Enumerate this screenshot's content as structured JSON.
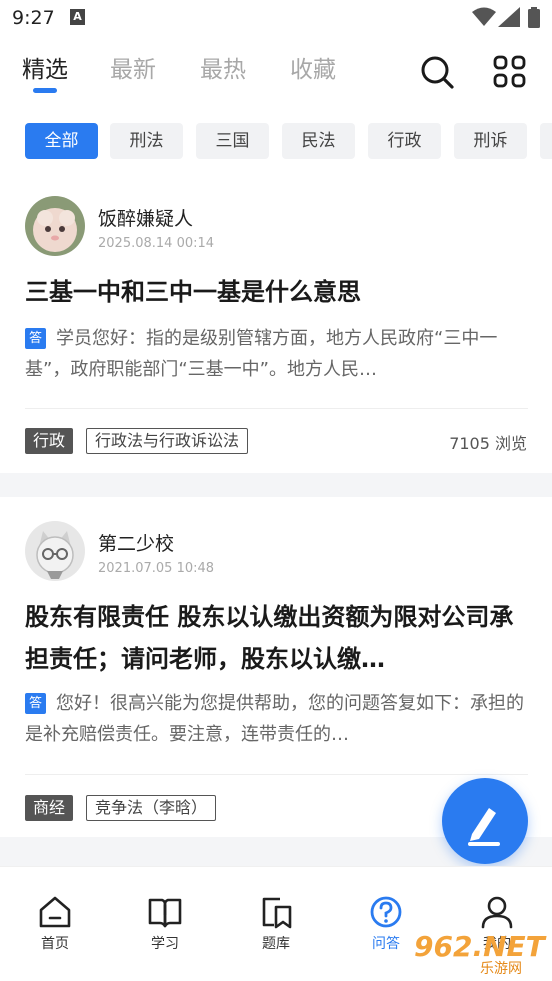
{
  "status_bar": {
    "time": "9:27",
    "notif_icon": "A"
  },
  "tabs": [
    {
      "label": "精选",
      "active": true
    },
    {
      "label": "最新",
      "active": false
    },
    {
      "label": "最热",
      "active": false
    },
    {
      "label": "收藏",
      "active": false
    }
  ],
  "header_icons": [
    "search-icon",
    "grid-apps-icon"
  ],
  "chips": [
    {
      "label": "全部",
      "active": true
    },
    {
      "label": "刑法",
      "active": false
    },
    {
      "label": "三国",
      "active": false
    },
    {
      "label": "民法",
      "active": false
    },
    {
      "label": "行政",
      "active": false
    },
    {
      "label": "刑诉",
      "active": false
    }
  ],
  "posts": [
    {
      "user": "饭醉嫌疑人",
      "date": "2025.08.14  00:14",
      "title": "三基一中和三中一基是什么意思",
      "answer_badge": "答",
      "answer": "学员您好：指的是级别管辖方面，地方人民政府“三中一基”，政府职能部门“三基一中”。地方人民…",
      "category": "行政",
      "topic": "行政法与行政诉讼法",
      "views": "7105 浏览"
    },
    {
      "user": "第二少校",
      "date": "2021.07.05  10:48",
      "title": "股东有限责任 股东以认缴出资额为限对公司承担责任；请问老师，股东以认缴…",
      "answer_badge": "答",
      "answer": "您好！很高兴能为您提供帮助，您的问题答复如下：承担的是补充赔偿责任。要注意，连带责任的…",
      "category": "商经",
      "topic": "竞争法（李晗）",
      "views": ""
    }
  ],
  "fab_icon": "compose-icon",
  "bottom_nav": [
    {
      "label": "首页",
      "icon": "home-icon",
      "active": false
    },
    {
      "label": "学习",
      "icon": "book-icon",
      "active": false
    },
    {
      "label": "题库",
      "icon": "question-bank-icon",
      "active": false
    },
    {
      "label": "问答",
      "icon": "qa-icon",
      "active": true
    },
    {
      "label": "我的",
      "icon": "profile-icon",
      "active": false
    }
  ],
  "watermark": {
    "big": "962.NET",
    "small": "乐游网"
  },
  "colors": {
    "accent": "#2a7bf0",
    "tag_dark": "#555555",
    "divider": "#eeeeee"
  }
}
